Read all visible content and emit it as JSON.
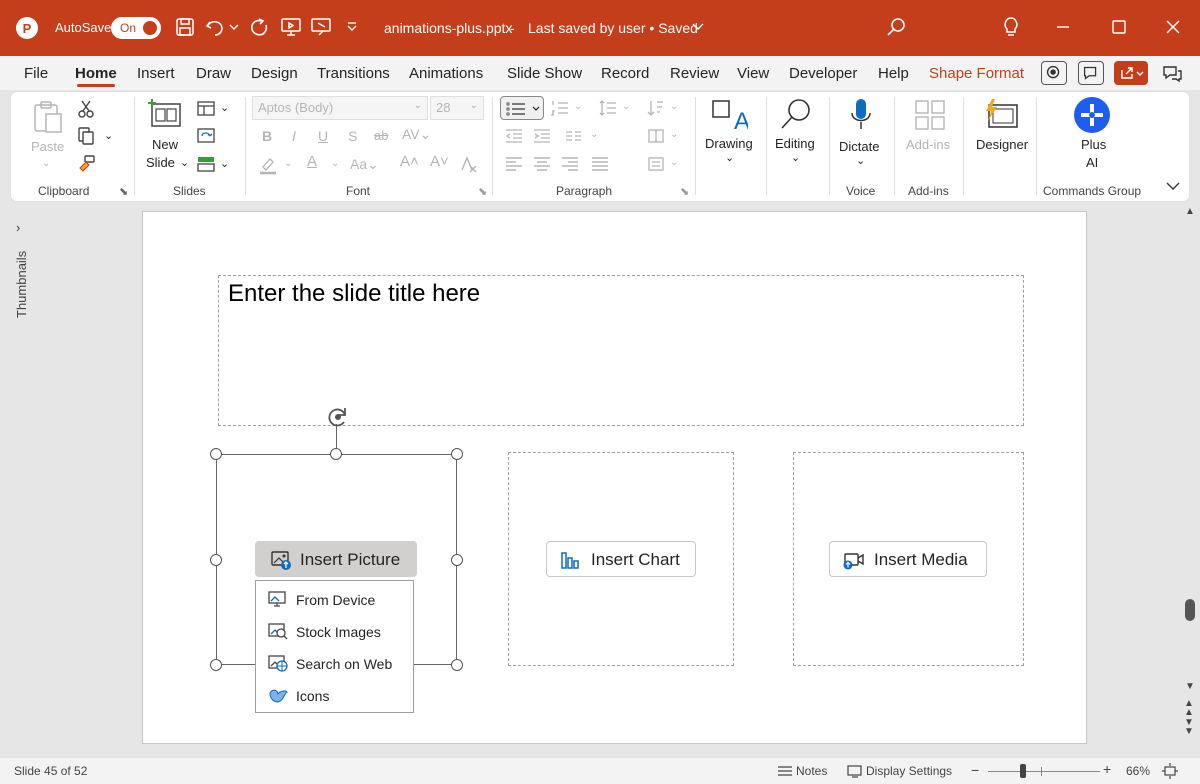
{
  "titlebar": {
    "autosave_label": "AutoSave",
    "autosave_state": "On",
    "filename": "animations-plus.pptx",
    "save_status": "Last saved by user • Saved",
    "accent_color": "#c43e1c"
  },
  "menu": {
    "tabs": [
      "File",
      "Home",
      "Insert",
      "Draw",
      "Design",
      "Transitions",
      "Animations",
      "Slide Show",
      "Record",
      "Review",
      "View",
      "Developer",
      "Help",
      "Shape Format"
    ],
    "active_tab": "Home"
  },
  "ribbon": {
    "clipboard": {
      "label": "Clipboard",
      "paste": "Paste"
    },
    "slides": {
      "label": "Slides",
      "new_slide_1": "New",
      "new_slide_2": "Slide"
    },
    "font": {
      "label": "Font",
      "font_name": "Aptos (Body)",
      "font_size": "28"
    },
    "paragraph": {
      "label": "Paragraph"
    },
    "drawing": {
      "label": "Drawing"
    },
    "editing": {
      "label": "Editing"
    },
    "voice": {
      "label": "Voice",
      "dictate": "Dictate"
    },
    "addins": {
      "label": "Add-ins",
      "button": "Add-ins"
    },
    "designer": {
      "label": "Designer"
    },
    "plusai": {
      "label_1": "Plus",
      "label_2": "AI",
      "group": "Commands Group"
    }
  },
  "left_pane": {
    "label": "Thumbnails"
  },
  "slide": {
    "title_placeholder": "Enter the slide title here",
    "insert_picture": "Insert Picture",
    "insert_chart": "Insert Chart",
    "insert_media": "Insert Media",
    "dropdown": [
      "From Device",
      "Stock Images",
      "Search on Web",
      "Icons"
    ]
  },
  "status": {
    "slide_info": "Slide 45 of 52",
    "notes": "Notes",
    "display_settings": "Display Settings",
    "zoom": "66%"
  }
}
